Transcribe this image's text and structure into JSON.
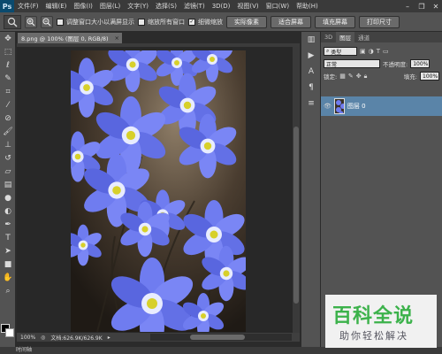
{
  "app": {
    "logo": "Ps"
  },
  "menu": {
    "items": [
      "文件(F)",
      "编辑(E)",
      "图像(I)",
      "图层(L)",
      "文字(Y)",
      "选择(S)",
      "滤镜(T)",
      "3D(D)",
      "视图(V)",
      "窗口(W)",
      "帮助(H)"
    ]
  },
  "window_controls": {
    "minimize": "–",
    "restore": "❐",
    "close": "✕"
  },
  "options": {
    "resize_windows_label": "调整窗口大小以满屏显示",
    "resize_windows_checked": false,
    "zoom_all_label": "缩放所有窗口",
    "zoom_all_checked": false,
    "scrubby_zoom_label": "细微缩放",
    "scrubby_zoom_checked": true,
    "actual_pixels": "实际像素",
    "fit_screen": "适合屏幕",
    "fill_screen": "填充屏幕",
    "print_size": "打印尺寸"
  },
  "document": {
    "tab_title": "8.png @ 100% (图层 0, RGB/8)",
    "tab_close": "×",
    "zoom": "100%",
    "doc_info": "文档:626.9K/626.9K"
  },
  "bottom": {
    "timeline_label": "时间轴"
  },
  "layers_panel": {
    "tabs": [
      "3D",
      "图层",
      "通道"
    ],
    "active_tab": 1,
    "filter_kind": "类型",
    "blend_mode": "正常",
    "opacity_label": "不透明度:",
    "opacity_value": "100%",
    "lock_label": "锁定:",
    "fill_label": "填充:",
    "fill_value": "100%",
    "layers": [
      {
        "name": "图层 0",
        "visible": true
      }
    ]
  },
  "watermark": {
    "title": "百科全说",
    "subtitle": "助你轻松解决"
  },
  "colors": {
    "foreground": "#000000",
    "background": "#ffffff",
    "selected_layer": "#5a84a8",
    "watermark_green": "#3cb24b"
  }
}
